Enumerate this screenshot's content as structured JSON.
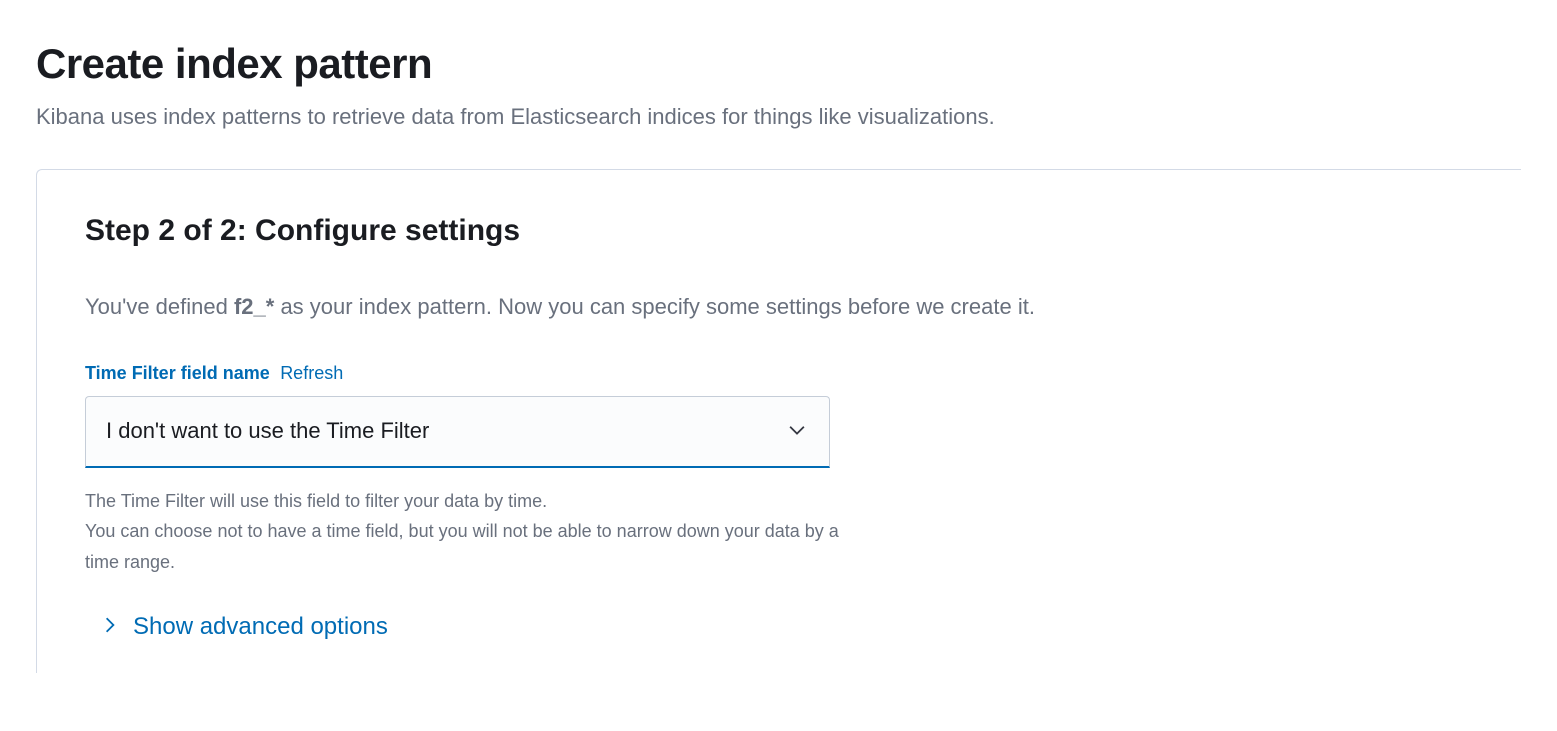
{
  "header": {
    "title": "Create index pattern",
    "subtitle": "Kibana uses index patterns to retrieve data from Elasticsearch indices for things like visualizations."
  },
  "step": {
    "title": "Step 2 of 2: Configure settings",
    "description_prefix": "You've defined ",
    "index_pattern": "f2_*",
    "description_suffix": " as your index pattern. Now you can specify some settings before we create it."
  },
  "time_filter": {
    "label": "Time Filter field name",
    "refresh_label": "Refresh",
    "selected_value": "I don't want to use the Time Filter",
    "help_line1": "The Time Filter will use this field to filter your data by time.",
    "help_line2": "You can choose not to have a time field, but you will not be able to narrow down your data by a time range."
  },
  "advanced": {
    "toggle_label": "Show advanced options"
  }
}
